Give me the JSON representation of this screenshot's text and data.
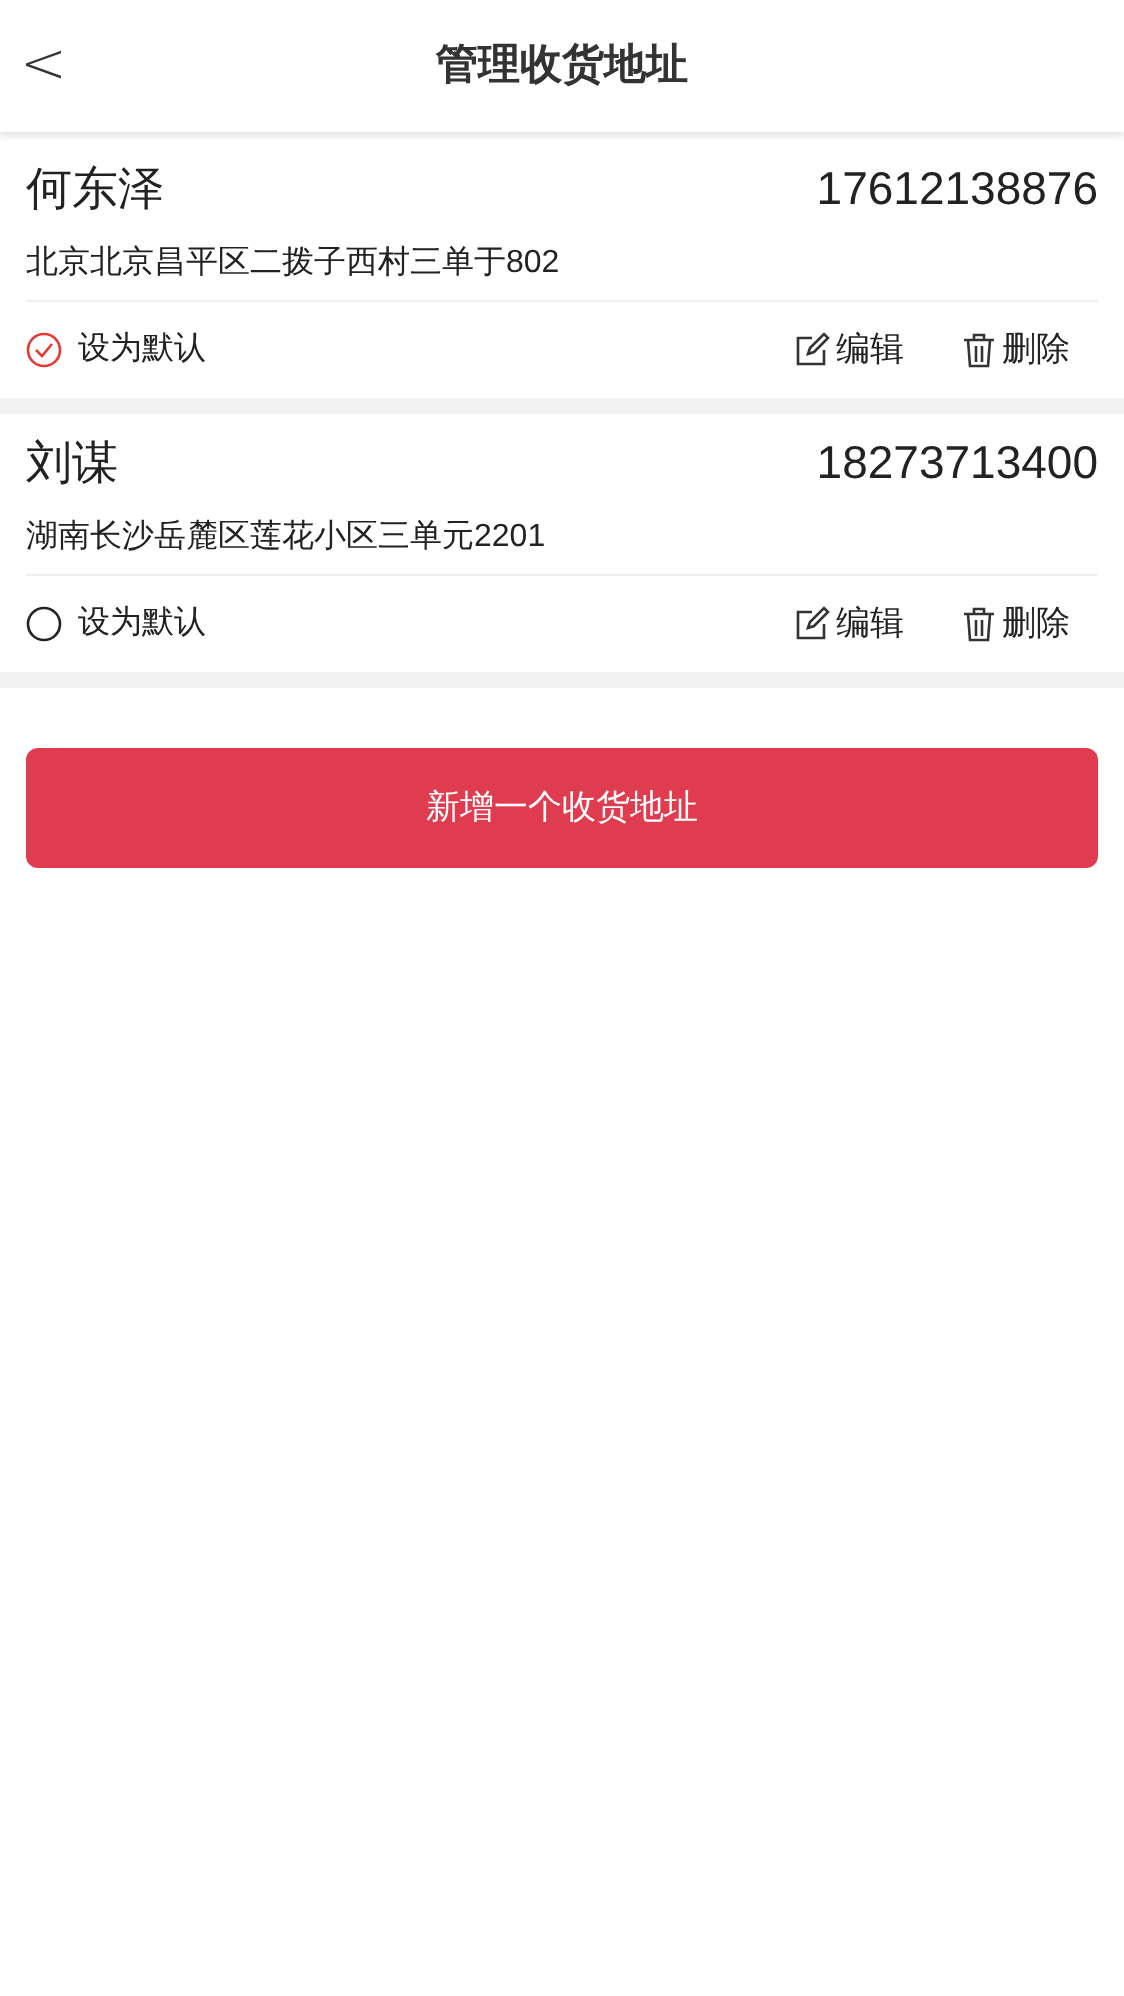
{
  "header": {
    "back": "<",
    "title": "管理收货地址"
  },
  "addresses": [
    {
      "name": "何东泽",
      "phone": "17612138876",
      "address": "北京北京昌平区二拨子西村三单于802",
      "default_label": "设为默认",
      "selected": true,
      "edit": "编辑",
      "delete": "删除"
    },
    {
      "name": "刘谋",
      "phone": "18273713400",
      "address": "湖南长沙岳麓区莲花小区三单元2201",
      "default_label": "设为默认",
      "selected": false,
      "edit": "编辑",
      "delete": "删除"
    }
  ],
  "add_button": "新增一个收货地址"
}
